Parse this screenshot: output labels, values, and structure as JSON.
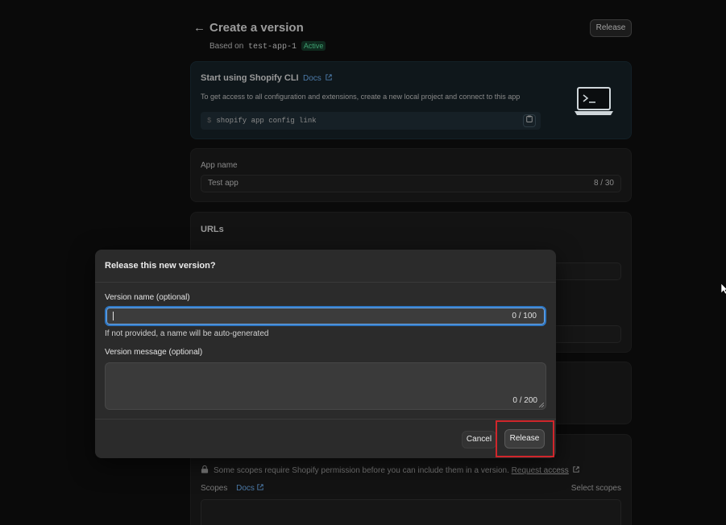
{
  "header": {
    "back_icon": "arrow-left-icon",
    "title": "Create a version",
    "based_on_prefix": "Based on",
    "based_on_app": "test-app-1",
    "status_badge": "Active",
    "release_label": "Release"
  },
  "cli_card": {
    "title": "Start using Shopify CLI",
    "docs_label": "Docs",
    "description": "To get access to all configuration and extensions, create a new local project and connect to this app",
    "command_prompt": "$",
    "command": "shopify app config link",
    "copy_icon": "clipboard-icon",
    "illustration_icon": "laptop-terminal-icon"
  },
  "app_name": {
    "label": "App name",
    "value": "Test app",
    "counter": "8 / 30"
  },
  "urls": {
    "title": "URLs"
  },
  "scopes": {
    "note": "Some scopes require Shopify permission before you can include them in a version.",
    "request_access": "Request access",
    "label": "Scopes",
    "docs_label": "Docs",
    "select_label": "Select scopes"
  },
  "modal": {
    "title": "Release this new version?",
    "version_name_label": "Version name (optional)",
    "version_name_value": "",
    "version_name_counter": "0 / 100",
    "version_name_help": "If not provided, a name will be auto-generated",
    "version_message_label": "Version message (optional)",
    "version_message_value": "",
    "version_message_counter": "0 / 200",
    "cancel_label": "Cancel",
    "release_label": "Release"
  },
  "colors": {
    "accent_focus": "#2f78c4",
    "badge_green": "#3fa071",
    "highlight_red": "#d0262b",
    "link_blue": "#4c7aa8"
  }
}
